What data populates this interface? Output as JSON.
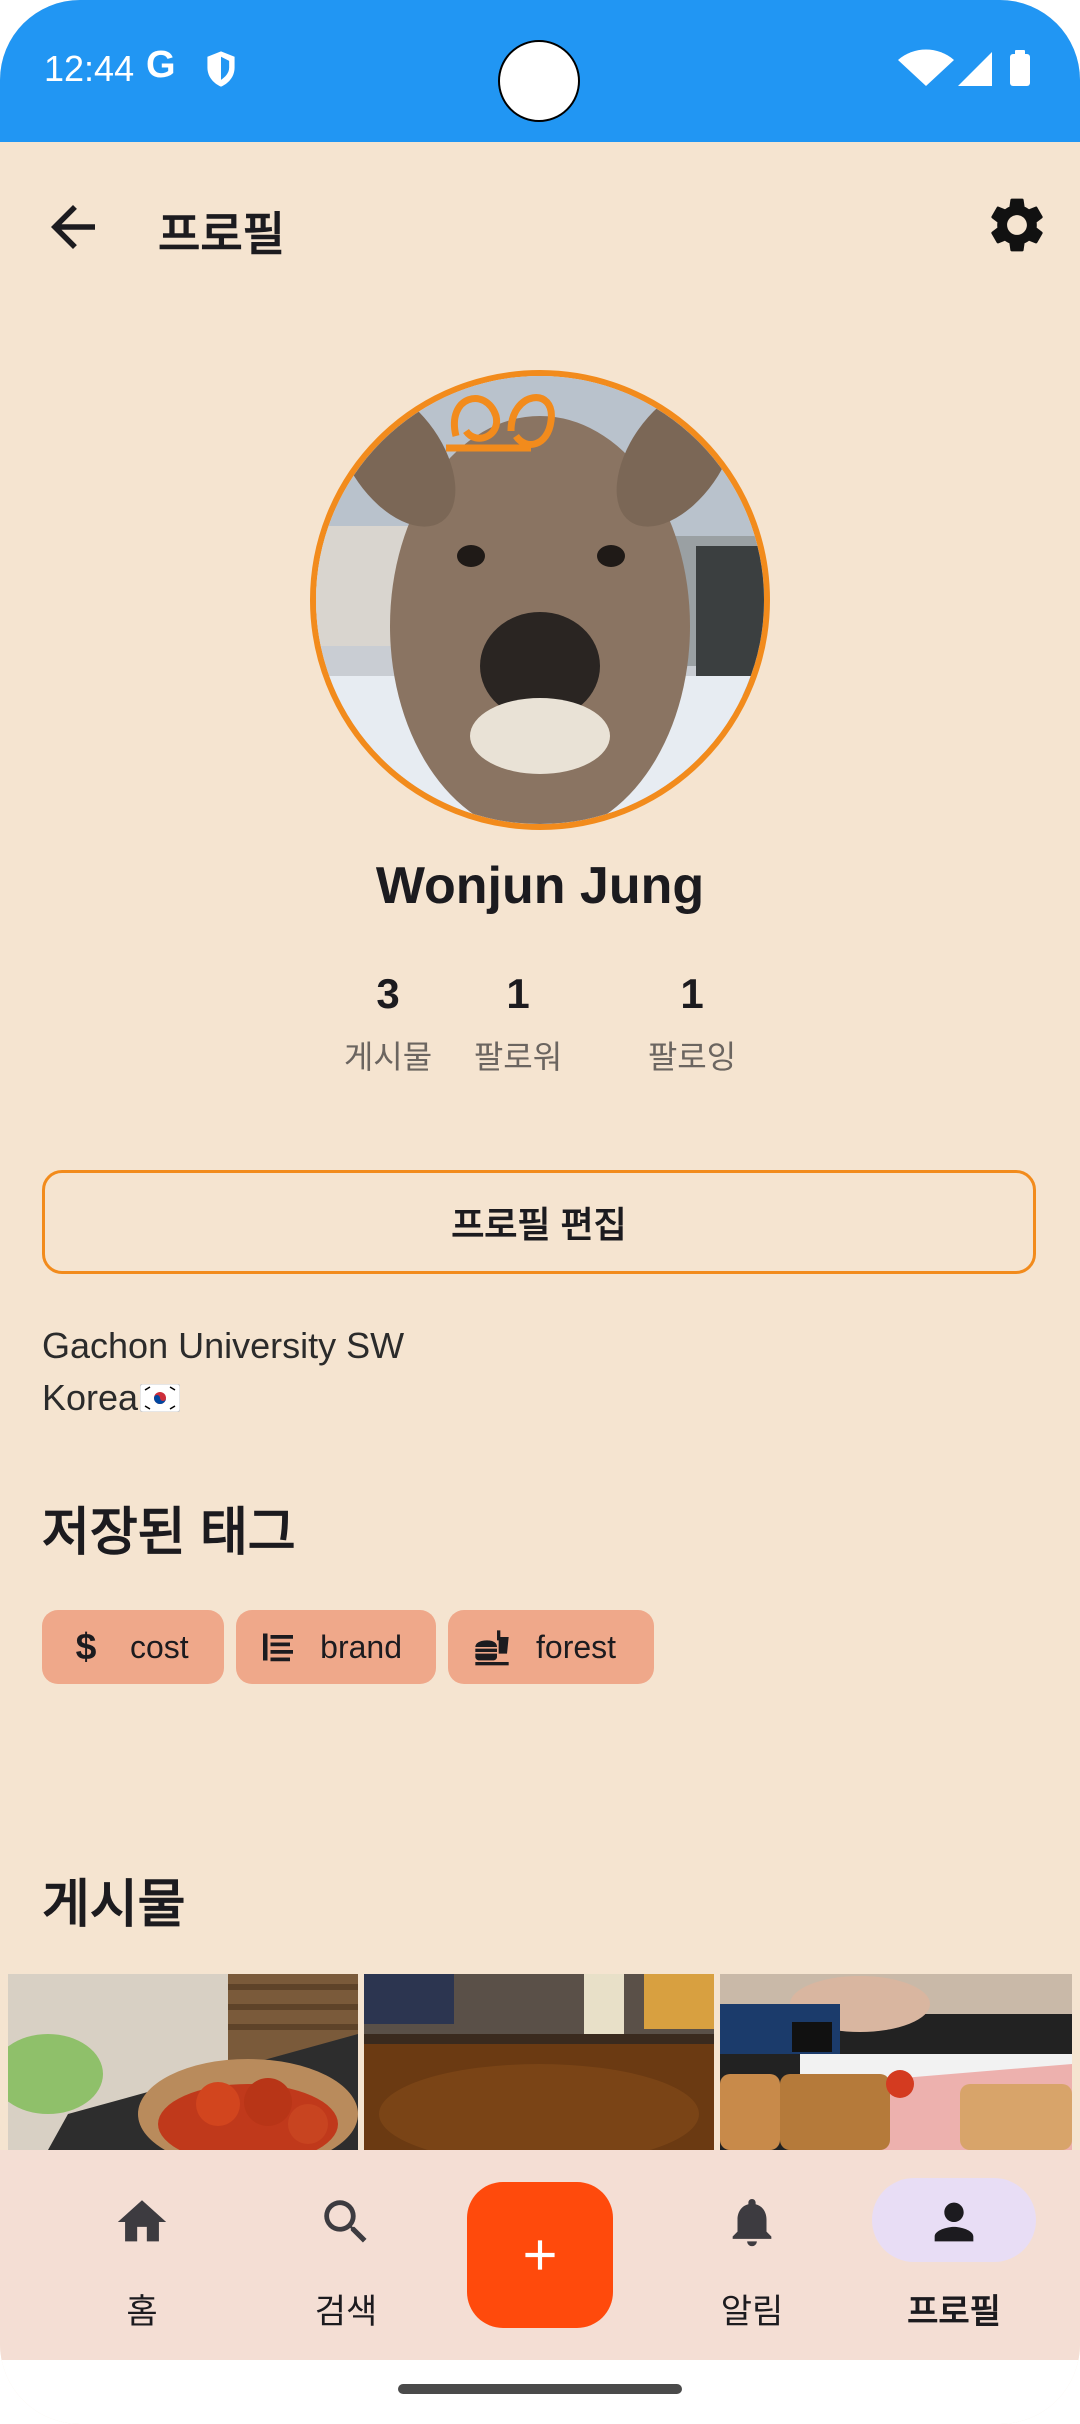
{
  "status_bar": {
    "time": "12:44",
    "g_label": "G"
  },
  "header": {
    "title": "프로필"
  },
  "profile": {
    "name": "Wonjun Jung",
    "stats": [
      {
        "value": "3",
        "label": "게시물"
      },
      {
        "value": "1",
        "label": "팔로워"
      },
      {
        "value": "1",
        "label": "팔로잉"
      }
    ],
    "edit_button": "프로필 편집",
    "bio_line1": "Gachon University SW",
    "bio_line2": "Korea"
  },
  "saved_tags": {
    "title": "저장된 태그",
    "chips": [
      {
        "label": "cost",
        "icon": "dollar-icon"
      },
      {
        "label": "brand",
        "icon": "list-icon"
      },
      {
        "label": "forest",
        "icon": "fastfood-icon"
      }
    ]
  },
  "posts": {
    "title": "게시물"
  },
  "bottom_nav": {
    "items": [
      {
        "label": "홈",
        "icon": "home-icon"
      },
      {
        "label": "검색",
        "icon": "search-icon"
      },
      {
        "label": "알림",
        "icon": "bell-icon"
      },
      {
        "label": "프로필",
        "icon": "person-icon",
        "active": true
      }
    ],
    "fab_icon": "plus-icon"
  },
  "colors": {
    "status_bar": "#2196f3",
    "background": "#f5e4d0",
    "accent_orange": "#f28b1c",
    "chip": "#efa88a",
    "fab": "#ff4a0c",
    "nav_bg": "#f4ded4",
    "nav_active": "#e8ddf5"
  }
}
